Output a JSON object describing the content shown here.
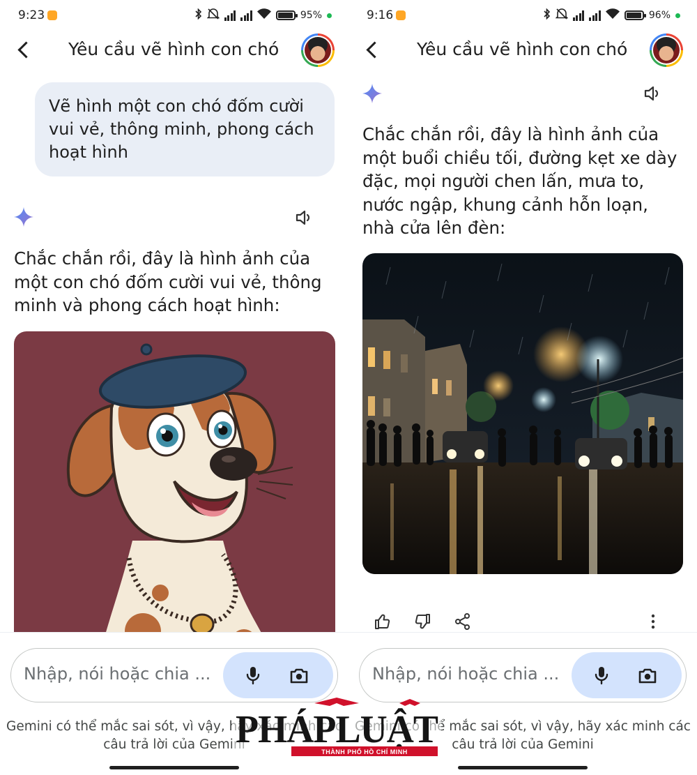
{
  "left": {
    "status": {
      "time": "9:23",
      "battery_pct": "95",
      "battery_level": 0.95
    },
    "appbar": {
      "title": "Yêu cầu vẽ hình con chó"
    },
    "user_prompt": "Vẽ hình một con chó đốm cười vui vẻ, thông minh, phong cách hoạt hình",
    "reply_text": "Chắc chắn rồi, đây là hình ảnh của một con chó đốm cười vui vẻ, thông minh và phong cách hoạt hình:",
    "input": {
      "placeholder": "Nhập, nói hoặc chia ..."
    },
    "disclaimer": "Gemini có thể mắc sai sót, vì vậy, hãy xác minh các câu trả lời của Gemini"
  },
  "right": {
    "status": {
      "time": "9:16",
      "battery_pct": "96",
      "battery_level": 0.96
    },
    "appbar": {
      "title": "Yêu cầu vẽ hình con chó"
    },
    "reply_text": "Chắc chắn rồi, đây là hình ảnh của một buổi chiều tối, đường kẹt xe dày đặc, mọi người chen lấn, mưa to, nước ngập, khung cảnh hỗn loạn, nhà cửa lên đèn:",
    "input": {
      "placeholder": "Nhập, nói hoặc chia ..."
    },
    "disclaimer": "Gemini có thể mắc sai sót, vì vậy, hãy xác minh các câu trả lời của Gemini"
  },
  "icons": {
    "back": "chevron-left-icon",
    "sparkle": "gemini-sparkle-icon",
    "speaker": "speaker-icon",
    "mic": "mic-icon",
    "camera": "camera-icon",
    "thumb_up": "thumb-up-icon",
    "thumb_down": "thumb-down-icon",
    "share": "share-icon",
    "more": "more-vert-icon"
  },
  "watermark": {
    "brand": "PHÁP LUẬT",
    "sub": "THÀNH PHỐ HỒ CHÍ MINH"
  },
  "colors": {
    "bubble": "#e9eef6",
    "input_buttons": "#d3e3fd",
    "sparkle_blue": "#4285f4",
    "watermark_red": "#d0112b",
    "dog_background": "#7b3a44"
  }
}
